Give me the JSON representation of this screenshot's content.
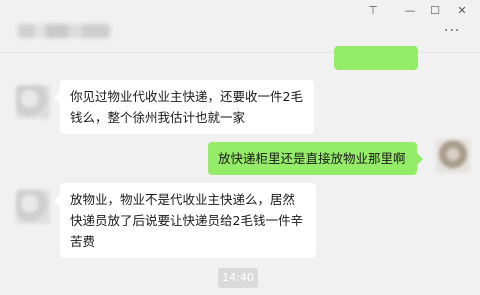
{
  "window": {
    "pin_glyph": "⊤",
    "minimize_glyph": "—",
    "maximize_glyph": "☐",
    "close_glyph": "✕",
    "more_glyph": "···"
  },
  "messages": [
    {
      "side": "left",
      "text": "你见过物业代收业主快递，还要收一件2毛钱么，整个徐州我估计也就一家"
    },
    {
      "side": "right",
      "text": "放快递柜里还是直接放物业那里啊"
    },
    {
      "side": "left",
      "text": "放物业，物业不是代收业主快递么，居然快递员放了后说要让快递员给2毛钱一件辛苦费"
    }
  ],
  "timestamp": "14:40",
  "colors": {
    "outgoing_bubble": "#95ec69",
    "incoming_bubble": "#ffffff",
    "background": "#f1f1f1"
  }
}
